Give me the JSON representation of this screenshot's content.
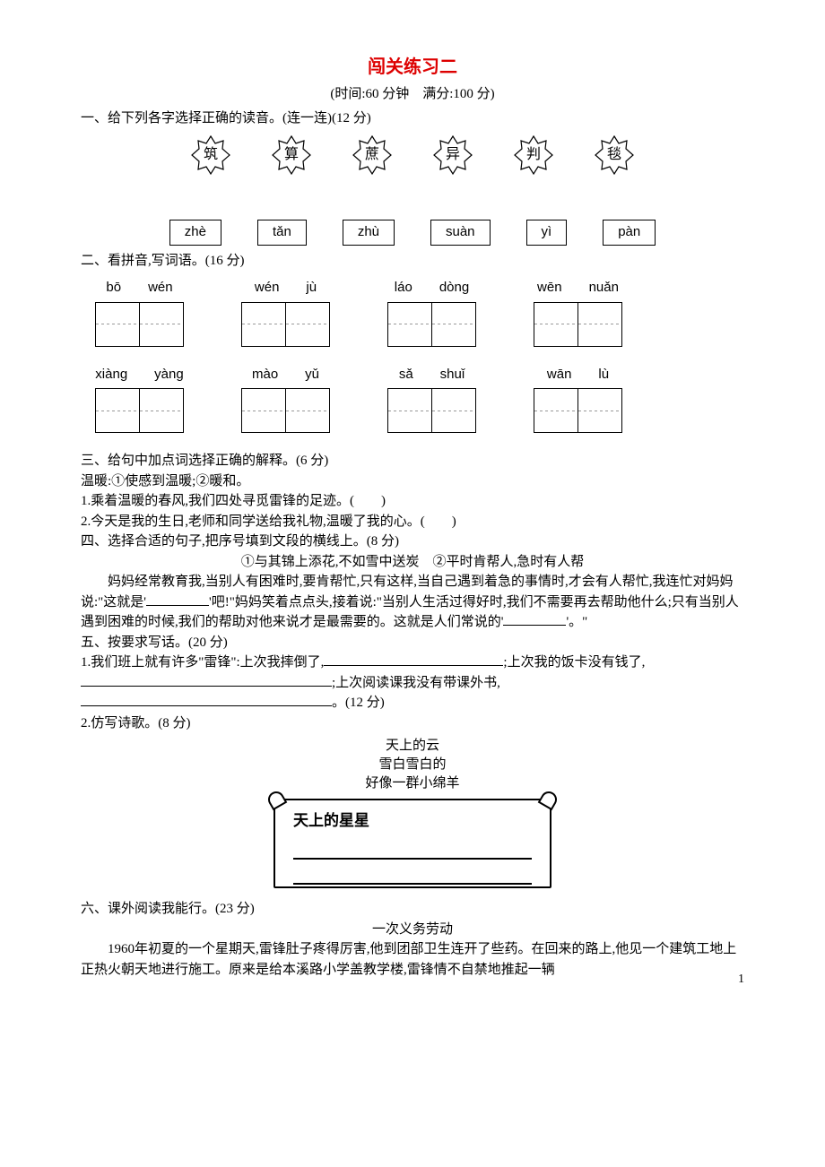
{
  "title": "闯关练习二",
  "subtitle": "(时间:60 分钟　满分:100 分)",
  "q1": {
    "heading": "一、给下列各字选择正确的读音。(连一连)(12 分)",
    "stars": [
      "筑",
      "算",
      "蔗",
      "异",
      "判",
      "毯"
    ],
    "options": [
      "zhè",
      "tǎn",
      "zhù",
      "suàn",
      "yì",
      "pàn"
    ]
  },
  "q2": {
    "heading": "二、看拼音,写词语。(16 分)",
    "row1": [
      {
        "py": [
          "bō",
          "wén"
        ]
      },
      {
        "py": [
          "wén",
          "jù"
        ]
      },
      {
        "py": [
          "láo",
          "dòng"
        ]
      },
      {
        "py": [
          "wēn",
          "nuǎn"
        ]
      }
    ],
    "row2": [
      {
        "py": [
          "xiàng",
          "yàng"
        ]
      },
      {
        "py": [
          "mào",
          "yǔ"
        ]
      },
      {
        "py": [
          "sǎ",
          "shuǐ"
        ]
      },
      {
        "py": [
          "wān",
          "lù"
        ]
      }
    ]
  },
  "q3": {
    "heading": "三、给句中加点词选择正确的解释。(6 分)",
    "defs": "温暖:①使感到温暖;②暖和。",
    "item1": "1.乘着温暖的春风,我们四处寻觅雷锋的足迹。(　　)",
    "item2": "2.今天是我的生日,老师和同学送给我礼物,温暖了我的心。(　　)"
  },
  "q4": {
    "heading": "四、选择合适的句子,把序号填到文段的横线上。(8 分)",
    "choices": "①与其锦上添花,不如雪中送炭　②平时肯帮人,急时有人帮",
    "para_before": "妈妈经常教育我,当别人有困难时,要肯帮忙,只有这样,当自己遇到着急的事情时,才会有人帮忙,我连忙对妈妈说:\"这就是'",
    "para_mid": "'吧!\"妈妈笑着点点头,接着说:\"当别人生活过得好时,我们不需要再去帮助他什么;只有当别人遇到困难的时候,我们的帮助对他来说才是最需要的。这就是人们常说的'",
    "para_after": "'。\""
  },
  "q5": {
    "heading": "五、按要求写话。(20 分)",
    "item1a": "1.我们班上就有许多\"雷锋\":上次我摔倒了,",
    "item1b": ";上次我的饭卡没有钱了,",
    "item1c": ";上次阅读课我没有带课外书,",
    "item1d": "。(12 分)",
    "item2": "2.仿写诗歌。(8 分)",
    "poem": [
      "天上的云",
      "雪白雪白的",
      "好像一群小绵羊"
    ],
    "scroll_title": "天上的星星"
  },
  "q6": {
    "heading": "六、课外阅读我能行。(23 分)",
    "passage_title": "一次义务劳动",
    "passage": "1960年初夏的一个星期天,雷锋肚子疼得厉害,他到团部卫生连开了些药。在回来的路上,他见一个建筑工地上正热火朝天地进行施工。原来是给本溪路小学盖教学楼,雷锋情不自禁地推起一辆"
  },
  "page_num": "1"
}
